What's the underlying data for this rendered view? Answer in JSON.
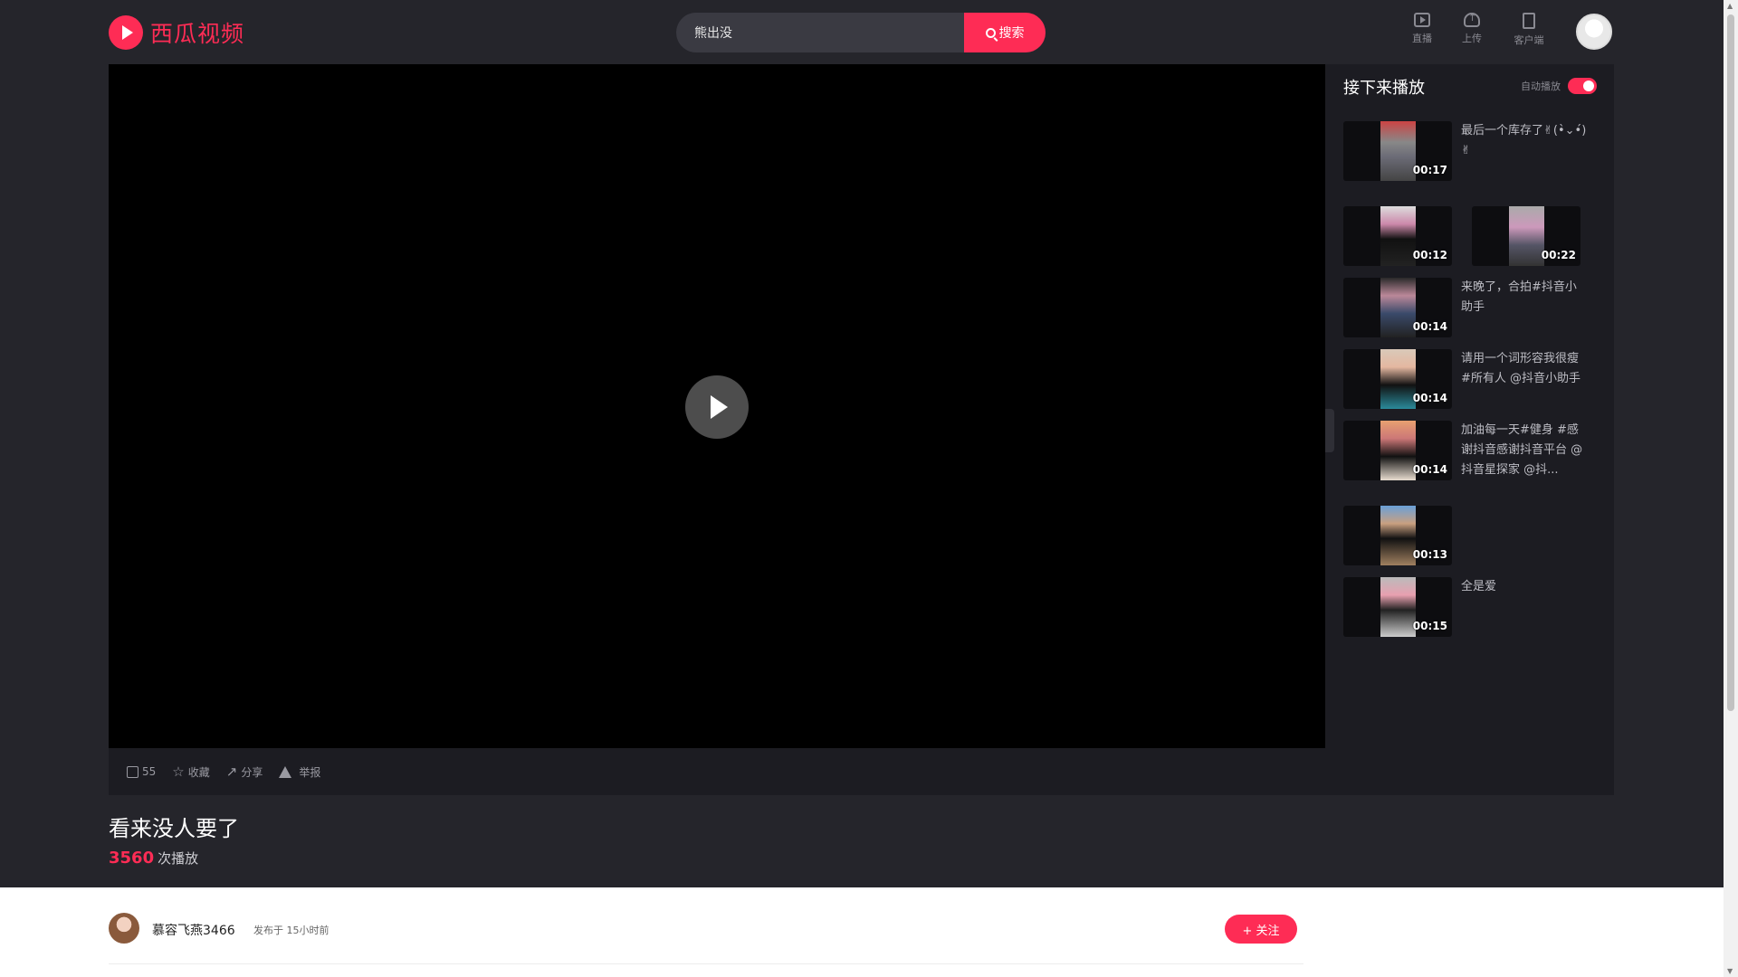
{
  "header": {
    "logo_text": "西瓜视频",
    "search_value": "熊出没",
    "search_button": "搜索",
    "tools": [
      {
        "label": "直播",
        "icon": "live-icon"
      },
      {
        "label": "上传",
        "icon": "upload-icon"
      },
      {
        "label": "客户端",
        "icon": "client-icon"
      }
    ]
  },
  "player": {
    "actions": {
      "like_count": "55",
      "favorite": "收藏",
      "share": "分享",
      "report": "举报"
    }
  },
  "sidebar": {
    "title": "接下来播放",
    "autoplay_label": "自动播放",
    "autoplay_on": true,
    "items": [
      {
        "duration": "00:17",
        "title": "最后一个库存了✌(•̀⌄•́)✌"
      },
      {
        "duration": "00:12",
        "title": ""
      },
      {
        "duration": "00:22",
        "title": ""
      },
      {
        "duration": "00:14",
        "title": "来晚了，合拍#抖音小助手"
      },
      {
        "duration": "00:14",
        "title": "请用一个词形容我很瘦 #所有人 @抖音小助手"
      },
      {
        "duration": "00:14",
        "title": "加油每一天#健身 #感谢抖音感谢抖音平台 @抖音星探家 @抖..."
      },
      {
        "duration": "00:13",
        "title": ""
      },
      {
        "duration": "00:15",
        "title": "全是爱"
      }
    ]
  },
  "video": {
    "title": "看来没人要了",
    "play_count": "3560",
    "play_suffix": "次播放"
  },
  "author": {
    "name": "慕容飞燕3466",
    "published": "发布于 15小时前",
    "follow_label": "+ 关注"
  },
  "colors": {
    "accent": "#fe2c55",
    "background": "#25252b",
    "stage": "#1c1c22"
  }
}
